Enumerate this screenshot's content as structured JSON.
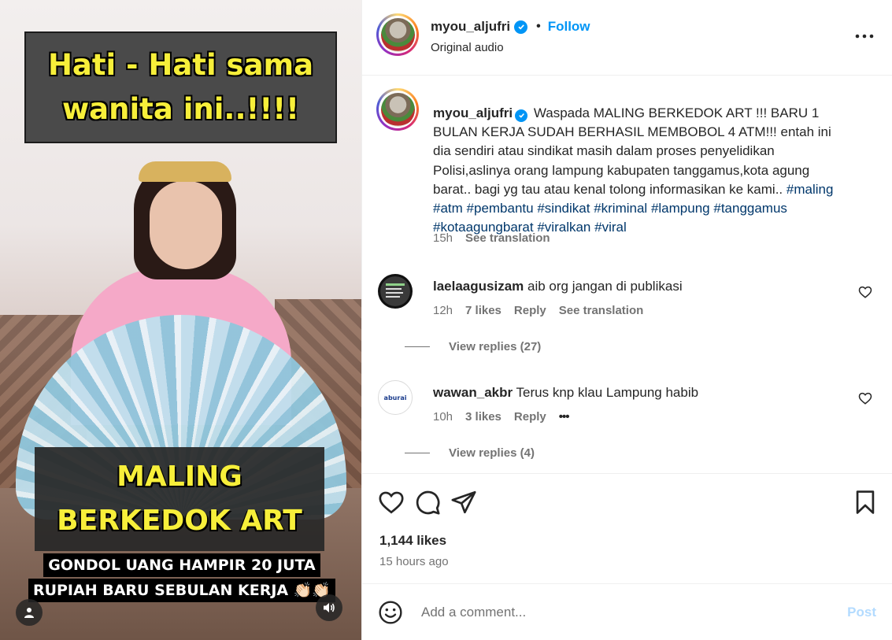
{
  "media": {
    "caption_top": "Hati - Hati sama\nwanita ini..!!!!",
    "caption_main": "MALING\nBERKEDOK ART",
    "caption_sub_1": "GONDOL UANG HAMPIR 20 JUTA",
    "caption_sub_2": "RUPIAH BARU SEBULAN KERJA 👏🏻👏🏻",
    "user_icon": "person-icon",
    "audio_icon": "speaker-icon"
  },
  "header": {
    "username": "myou_aljufri",
    "separator": "•",
    "follow_label": "Follow",
    "subtitle": "Original audio",
    "more_icon": "more-horizontal-icon"
  },
  "caption": {
    "username": "myou_aljufri",
    "text": "Waspada MALING BERKEDOK ART !!! BARU 1 BULAN KERJA SUDAH BERHASIL MEMBOBOL 4 ATM!!! entah ini dia sendiri atau sindikat masih dalam proses penyelidikan Polisi,aslinya orang lampung kabupaten tanggamus,kota agung barat.. bagi yg tau atau kenal tolong informasikan ke kami..",
    "hashtags": [
      "#maling",
      "#atm",
      "#pembantu",
      "#sindikat",
      "#kriminal",
      "#lampung",
      "#tanggamus",
      "#kotaagungbarat",
      "#viralkan",
      "#viral"
    ],
    "time": "15h",
    "see_translation": "See translation"
  },
  "comments": [
    {
      "username": "laelaagusizam",
      "text": "aib org jangan di publikasi",
      "time": "12h",
      "likes": "7 likes",
      "reply": "Reply",
      "see_translation": "See translation",
      "view_replies": "View replies (27)"
    },
    {
      "username": "wawan_akbr",
      "text": "Terus knp klau Lampung habib",
      "avatar_text": "aburai",
      "time": "10h",
      "likes": "3 likes",
      "reply": "Reply",
      "more": "•••",
      "view_replies": "View replies (4)"
    }
  ],
  "actions": {
    "like_icon": "heart-icon",
    "comment_icon": "comment-icon",
    "share_icon": "paper-plane-icon",
    "save_icon": "bookmark-icon"
  },
  "stats": {
    "likes": "1,144 likes",
    "time_ago": "15 hours ago"
  },
  "comment_box": {
    "placeholder": "Add a comment...",
    "post_label": "Post",
    "emoji_icon": "smiley-icon"
  },
  "colors": {
    "link_blue": "#0095f6",
    "hashtag": "#00376b",
    "caption_yellow": "#f7ef3a",
    "muted": "#737373"
  }
}
